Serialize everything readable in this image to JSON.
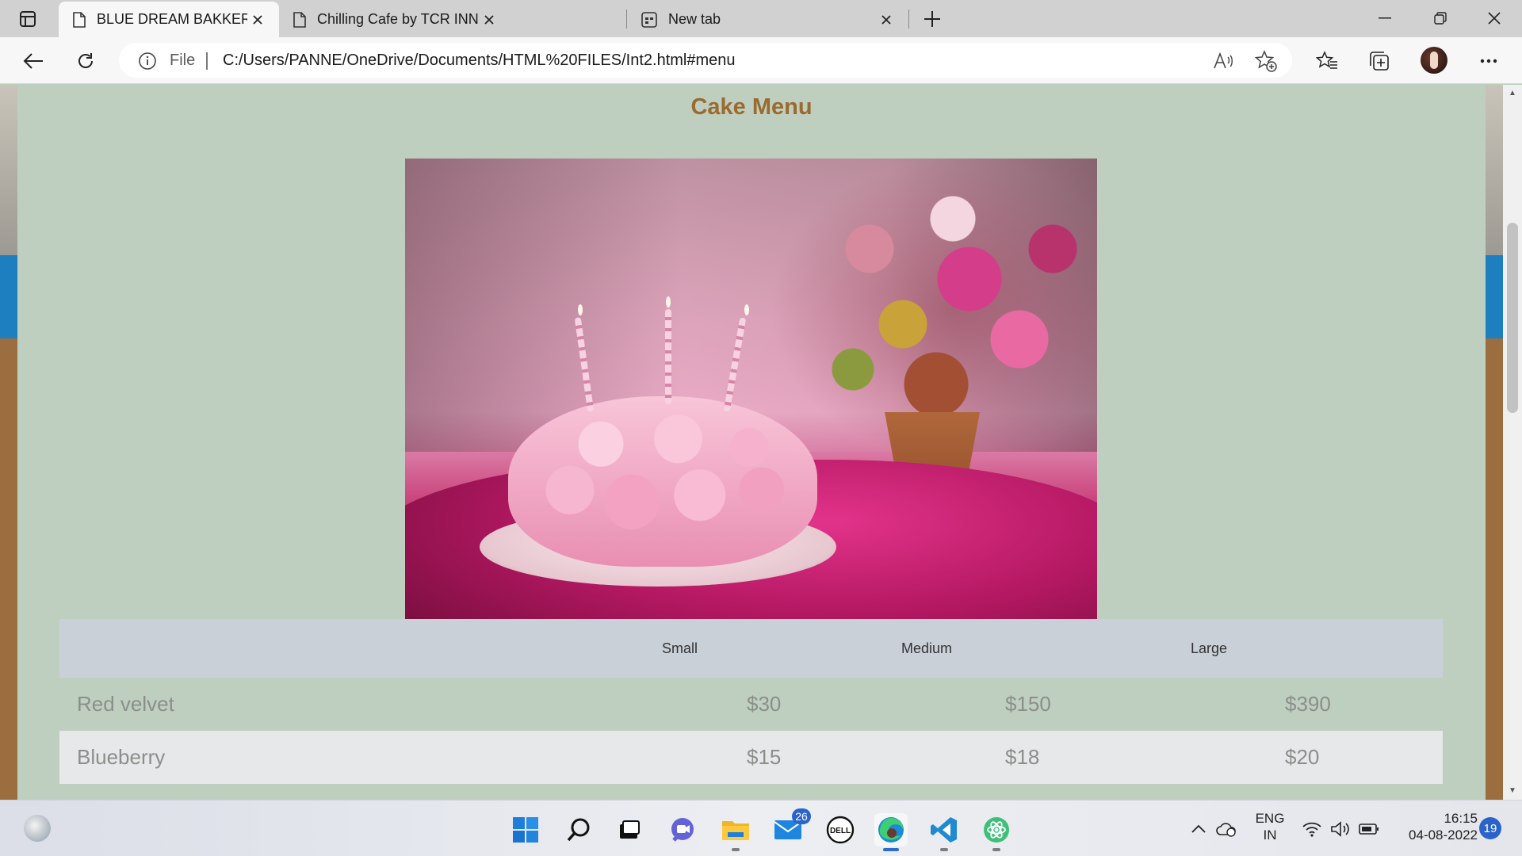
{
  "browser": {
    "tabs": [
      {
        "title": "BLUE DREAM BAKKERY",
        "active": true
      },
      {
        "title": "Chilling Cafe by TCR INNOVATIO",
        "active": false
      },
      {
        "title": "New tab",
        "active": false
      }
    ],
    "address": {
      "scheme_label": "File",
      "url": "C:/Users/PANNE/OneDrive/Documents/HTML%20FILES/Int2.html#menu"
    }
  },
  "page": {
    "title": "Cake Menu",
    "image_alt": "Pink rose cake with candles beside a flower vase",
    "price_table": {
      "headers": [
        "",
        "Small",
        "Medium",
        "Large"
      ],
      "rows": [
        {
          "name": "Red velvet",
          "small": "$30",
          "medium": "$150",
          "large": "$390"
        },
        {
          "name": "Blueberry",
          "small": "$15",
          "medium": "$18",
          "large": "$20"
        }
      ]
    }
  },
  "taskbar": {
    "apps": [
      "start",
      "search",
      "task-view",
      "teams-chat",
      "file-explorer",
      "mail",
      "dell",
      "edge",
      "vscode",
      "atom"
    ],
    "mail_badge": "26",
    "language": {
      "line1": "ENG",
      "line2": "IN"
    },
    "clock": {
      "time": "16:15",
      "date": "04-08-2022"
    },
    "notifications": "19"
  },
  "colors": {
    "page_bg": "#bfcfbf",
    "title": "#9a6a2f",
    "header_row": "#c9d0d8",
    "alt_row": "#e6e8ea",
    "accent_blue": "#2a63c9"
  }
}
